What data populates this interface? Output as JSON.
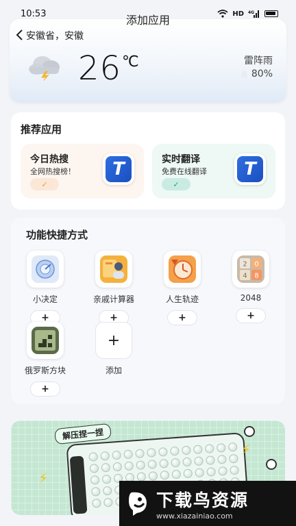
{
  "status_bar": {
    "time": "10:53",
    "network": "HD",
    "signal": "4G"
  },
  "header": {
    "back_icon": "chevron-left-icon",
    "location": "安徽省，安徽",
    "title": "添加应用"
  },
  "weather": {
    "temp": "26",
    "unit": "℃",
    "condition": "雷阵雨",
    "humidity": "80%",
    "icon": "thunderstorm-icon"
  },
  "recommended": {
    "title": "推荐应用",
    "items": [
      {
        "name": "今日热搜",
        "desc": "全网热搜榜！",
        "check": "✓",
        "bg": "#fdf6f0",
        "check_bg": "#fbe7d6",
        "check_color": "#e19a52"
      },
      {
        "name": "实时翻译",
        "desc": "免费在线翻译",
        "check": "✓",
        "bg": "#eef8f4",
        "check_bg": "#c9ece2",
        "check_color": "#2a9d7f"
      }
    ],
    "icon_letter": "T"
  },
  "shortcuts": {
    "title": "功能快捷方式",
    "items": [
      {
        "label": "小决定",
        "add": "+"
      },
      {
        "label": "亲戚计算器",
        "add": "+"
      },
      {
        "label": "人生轨迹",
        "add": "+"
      },
      {
        "label": "2048",
        "add": "+"
      },
      {
        "label": "俄罗斯方块",
        "add": "+"
      }
    ],
    "add_tile": {
      "symbol": "+",
      "label": "添加"
    },
    "tiles_2048": [
      "2",
      "0",
      "4",
      "8"
    ]
  },
  "banner": {
    "tag": "解压捏一捏"
  },
  "watermark": {
    "title": "下载鸟资源",
    "url": "www.xiazainiao.com"
  }
}
